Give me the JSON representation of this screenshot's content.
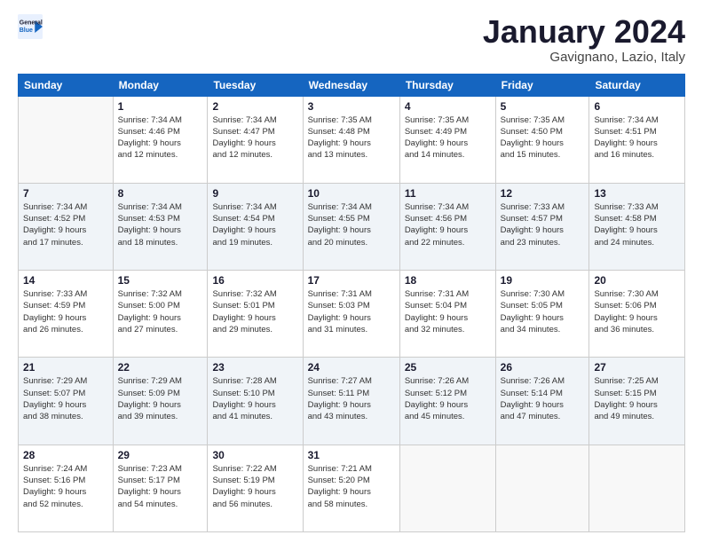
{
  "logo": {
    "line1": "General",
    "line2": "Blue"
  },
  "header": {
    "month": "January 2024",
    "location": "Gavignano, Lazio, Italy"
  },
  "weekdays": [
    "Sunday",
    "Monday",
    "Tuesday",
    "Wednesday",
    "Thursday",
    "Friday",
    "Saturday"
  ],
  "weeks": [
    [
      {
        "day": "",
        "info": ""
      },
      {
        "day": "1",
        "info": "Sunrise: 7:34 AM\nSunset: 4:46 PM\nDaylight: 9 hours\nand 12 minutes."
      },
      {
        "day": "2",
        "info": "Sunrise: 7:34 AM\nSunset: 4:47 PM\nDaylight: 9 hours\nand 12 minutes."
      },
      {
        "day": "3",
        "info": "Sunrise: 7:35 AM\nSunset: 4:48 PM\nDaylight: 9 hours\nand 13 minutes."
      },
      {
        "day": "4",
        "info": "Sunrise: 7:35 AM\nSunset: 4:49 PM\nDaylight: 9 hours\nand 14 minutes."
      },
      {
        "day": "5",
        "info": "Sunrise: 7:35 AM\nSunset: 4:50 PM\nDaylight: 9 hours\nand 15 minutes."
      },
      {
        "day": "6",
        "info": "Sunrise: 7:34 AM\nSunset: 4:51 PM\nDaylight: 9 hours\nand 16 minutes."
      }
    ],
    [
      {
        "day": "7",
        "info": "Sunrise: 7:34 AM\nSunset: 4:52 PM\nDaylight: 9 hours\nand 17 minutes."
      },
      {
        "day": "8",
        "info": "Sunrise: 7:34 AM\nSunset: 4:53 PM\nDaylight: 9 hours\nand 18 minutes."
      },
      {
        "day": "9",
        "info": "Sunrise: 7:34 AM\nSunset: 4:54 PM\nDaylight: 9 hours\nand 19 minutes."
      },
      {
        "day": "10",
        "info": "Sunrise: 7:34 AM\nSunset: 4:55 PM\nDaylight: 9 hours\nand 20 minutes."
      },
      {
        "day": "11",
        "info": "Sunrise: 7:34 AM\nSunset: 4:56 PM\nDaylight: 9 hours\nand 22 minutes."
      },
      {
        "day": "12",
        "info": "Sunrise: 7:33 AM\nSunset: 4:57 PM\nDaylight: 9 hours\nand 23 minutes."
      },
      {
        "day": "13",
        "info": "Sunrise: 7:33 AM\nSunset: 4:58 PM\nDaylight: 9 hours\nand 24 minutes."
      }
    ],
    [
      {
        "day": "14",
        "info": "Sunrise: 7:33 AM\nSunset: 4:59 PM\nDaylight: 9 hours\nand 26 minutes."
      },
      {
        "day": "15",
        "info": "Sunrise: 7:32 AM\nSunset: 5:00 PM\nDaylight: 9 hours\nand 27 minutes."
      },
      {
        "day": "16",
        "info": "Sunrise: 7:32 AM\nSunset: 5:01 PM\nDaylight: 9 hours\nand 29 minutes."
      },
      {
        "day": "17",
        "info": "Sunrise: 7:31 AM\nSunset: 5:03 PM\nDaylight: 9 hours\nand 31 minutes."
      },
      {
        "day": "18",
        "info": "Sunrise: 7:31 AM\nSunset: 5:04 PM\nDaylight: 9 hours\nand 32 minutes."
      },
      {
        "day": "19",
        "info": "Sunrise: 7:30 AM\nSunset: 5:05 PM\nDaylight: 9 hours\nand 34 minutes."
      },
      {
        "day": "20",
        "info": "Sunrise: 7:30 AM\nSunset: 5:06 PM\nDaylight: 9 hours\nand 36 minutes."
      }
    ],
    [
      {
        "day": "21",
        "info": "Sunrise: 7:29 AM\nSunset: 5:07 PM\nDaylight: 9 hours\nand 38 minutes."
      },
      {
        "day": "22",
        "info": "Sunrise: 7:29 AM\nSunset: 5:09 PM\nDaylight: 9 hours\nand 39 minutes."
      },
      {
        "day": "23",
        "info": "Sunrise: 7:28 AM\nSunset: 5:10 PM\nDaylight: 9 hours\nand 41 minutes."
      },
      {
        "day": "24",
        "info": "Sunrise: 7:27 AM\nSunset: 5:11 PM\nDaylight: 9 hours\nand 43 minutes."
      },
      {
        "day": "25",
        "info": "Sunrise: 7:26 AM\nSunset: 5:12 PM\nDaylight: 9 hours\nand 45 minutes."
      },
      {
        "day": "26",
        "info": "Sunrise: 7:26 AM\nSunset: 5:14 PM\nDaylight: 9 hours\nand 47 minutes."
      },
      {
        "day": "27",
        "info": "Sunrise: 7:25 AM\nSunset: 5:15 PM\nDaylight: 9 hours\nand 49 minutes."
      }
    ],
    [
      {
        "day": "28",
        "info": "Sunrise: 7:24 AM\nSunset: 5:16 PM\nDaylight: 9 hours\nand 52 minutes."
      },
      {
        "day": "29",
        "info": "Sunrise: 7:23 AM\nSunset: 5:17 PM\nDaylight: 9 hours\nand 54 minutes."
      },
      {
        "day": "30",
        "info": "Sunrise: 7:22 AM\nSunset: 5:19 PM\nDaylight: 9 hours\nand 56 minutes."
      },
      {
        "day": "31",
        "info": "Sunrise: 7:21 AM\nSunset: 5:20 PM\nDaylight: 9 hours\nand 58 minutes."
      },
      {
        "day": "",
        "info": ""
      },
      {
        "day": "",
        "info": ""
      },
      {
        "day": "",
        "info": ""
      }
    ]
  ]
}
